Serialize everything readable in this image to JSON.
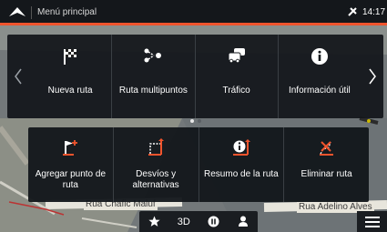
{
  "statusbar": {
    "title": "Menú principal",
    "time": "14:17",
    "accent_color": "#f0542d"
  },
  "top_menu": {
    "items": [
      {
        "label": "Nueva ruta",
        "icon": "checkered-flag-icon"
      },
      {
        "label": "Ruta multipuntos",
        "icon": "multipoint-route-icon"
      },
      {
        "label": "Tráfico",
        "icon": "traffic-cars-icon"
      },
      {
        "label": "Información útil",
        "icon": "info-icon"
      }
    ],
    "page_count": 2,
    "current_page": 1
  },
  "route_menu": {
    "items": [
      {
        "label": "Agregar punto de ruta",
        "icon": "add-waypoint-icon"
      },
      {
        "label": "Desvíos y alternativas",
        "icon": "detour-icon"
      },
      {
        "label": "Resumo de la ruta",
        "icon": "route-summary-icon"
      },
      {
        "label": "Eliminar ruta",
        "icon": "delete-route-icon"
      }
    ],
    "accent_color": "#f0542d"
  },
  "map": {
    "streets": [
      "Rua Chafic Maluf",
      "Rua Adelino Alves"
    ]
  },
  "toolbar": {
    "view_mode": "3D"
  }
}
